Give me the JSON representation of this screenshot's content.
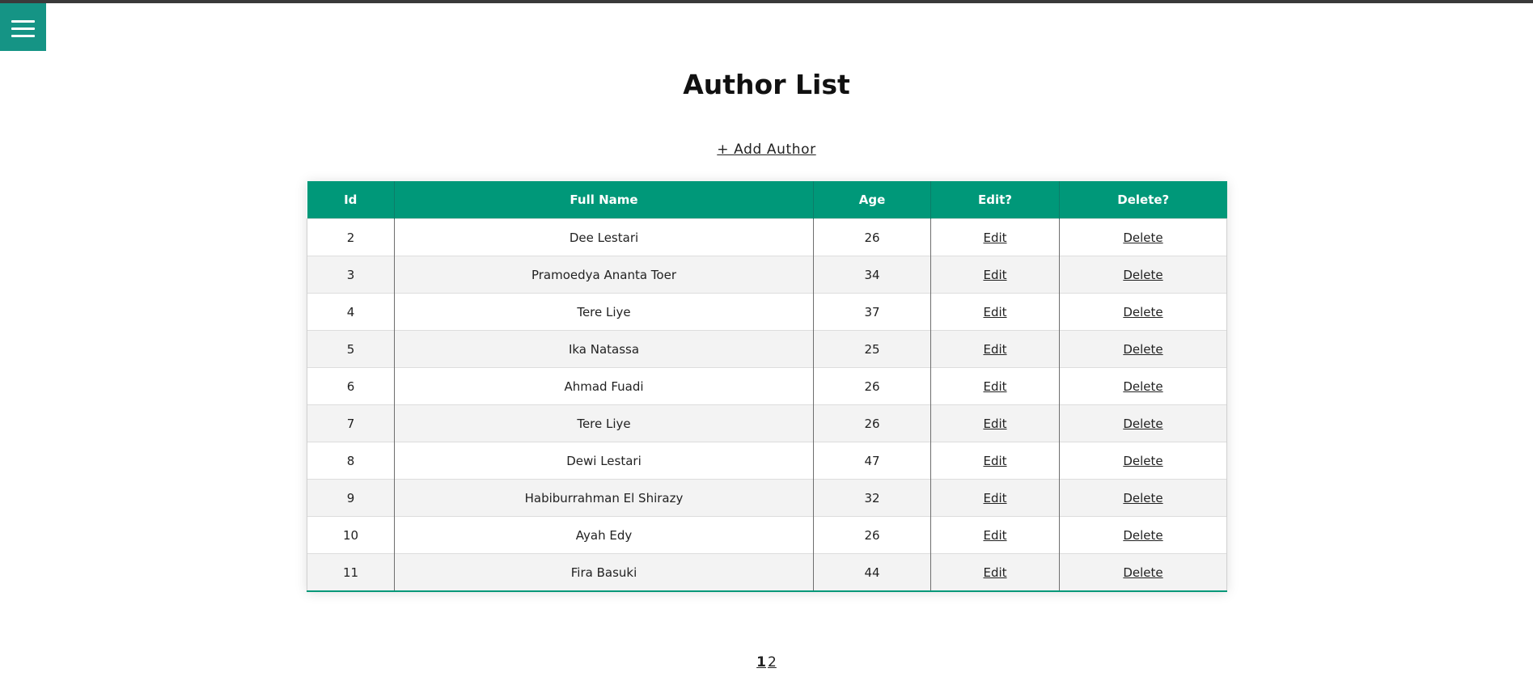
{
  "page": {
    "title": "Author List",
    "add_label": "+ Add Author"
  },
  "table": {
    "headers": [
      "Id",
      "Full Name",
      "Age",
      "Edit?",
      "Delete?"
    ],
    "edit_label": "Edit",
    "delete_label": "Delete",
    "rows": [
      {
        "id": "2",
        "name": "Dee Lestari",
        "age": "26"
      },
      {
        "id": "3",
        "name": "Pramoedya Ananta Toer",
        "age": "34"
      },
      {
        "id": "4",
        "name": "Tere Liye",
        "age": "37"
      },
      {
        "id": "5",
        "name": "Ika Natassa",
        "age": "25"
      },
      {
        "id": "6",
        "name": "Ahmad Fuadi",
        "age": "26"
      },
      {
        "id": "7",
        "name": "Tere Liye",
        "age": "26"
      },
      {
        "id": "8",
        "name": "Dewi Lestari",
        "age": "47"
      },
      {
        "id": "9",
        "name": "Habiburrahman El Shirazy",
        "age": "32"
      },
      {
        "id": "10",
        "name": "Ayah Edy",
        "age": "26"
      },
      {
        "id": "11",
        "name": "Fira Basuki",
        "age": "44"
      }
    ]
  },
  "pagination": {
    "pages": [
      "1",
      "2"
    ],
    "current": "1"
  },
  "colors": {
    "accent": "#009879",
    "menu": "#159485"
  },
  "icons": {
    "menu": "hamburger-menu-icon"
  }
}
